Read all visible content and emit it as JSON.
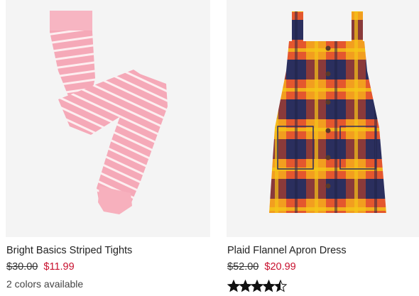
{
  "products": [
    {
      "name": "Bright Basics Striped Tights",
      "original_price": "$30.00",
      "sale_price": "$11.99",
      "colors_text": "2 colors available",
      "image_icon": "striped-tights-image"
    },
    {
      "name": "Plaid Flannel Apron Dress",
      "original_price": "$52.00",
      "sale_price": "$20.99",
      "rating": 4.5,
      "rating_max": 5,
      "image_icon": "plaid-dress-image"
    }
  ],
  "colors": {
    "sale": "#c8102e",
    "image_bg": "#f4f4f4",
    "tights_pink": "#f7b3bf",
    "stripe": "#fdeef0"
  }
}
